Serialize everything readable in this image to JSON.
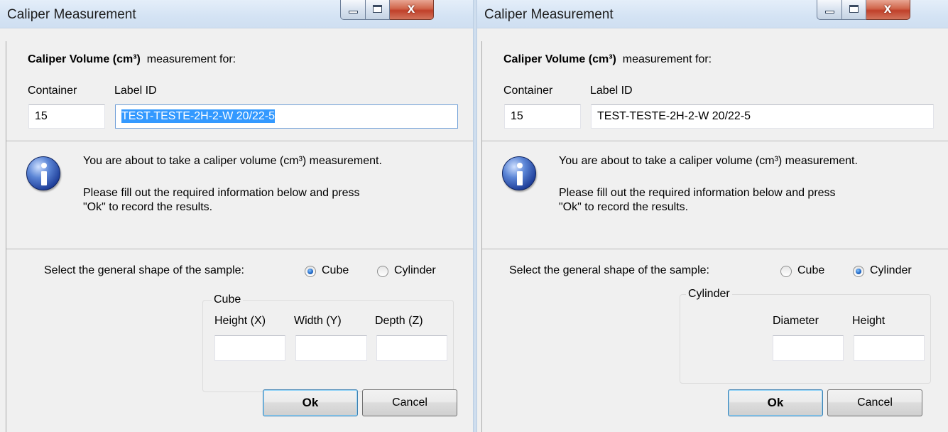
{
  "dialogs": [
    {
      "title": "Caliper Measurement",
      "header_bold": "Caliper Volume (cm³)",
      "header_rest": "measurement for:",
      "container_label": "Container",
      "label_id_label": "Label ID",
      "container_value": "15",
      "label_id_value": "TEST-TESTE-2H-2-W 20/22-5",
      "info_line1": "You are about to take a caliper volume (cm³) measurement.",
      "info_line2": "Please fill out the required information below and press",
      "info_line3": "\"Ok\" to record the results.",
      "shape_prompt": "Select the general shape of the sample:",
      "shape_options": [
        "Cube",
        "Cylinder"
      ],
      "selected_shape": "Cube",
      "group_title": "Cube",
      "fields": [
        "Height (X)",
        "Width (Y)",
        "Depth (Z)"
      ],
      "field_values": [
        "",
        "",
        ""
      ],
      "ok_label": "Ok",
      "cancel_label": "Cancel"
    },
    {
      "title": "Caliper Measurement",
      "header_bold": "Caliper Volume (cm³)",
      "header_rest": "measurement for:",
      "container_label": "Container",
      "label_id_label": "Label ID",
      "container_value": "15",
      "label_id_value": "TEST-TESTE-2H-2-W 20/22-5",
      "info_line1": "You are about to take a caliper volume (cm³) measurement.",
      "info_line2": "Please fill out the required information below and press",
      "info_line3": "\"Ok\" to record the results.",
      "shape_prompt": "Select the general shape of the sample:",
      "shape_options": [
        "Cube",
        "Cylinder"
      ],
      "selected_shape": "Cylinder",
      "group_title": "Cylinder",
      "fields": [
        "Diameter",
        "Height"
      ],
      "field_values": [
        "",
        ""
      ],
      "ok_label": "Ok",
      "cancel_label": "Cancel"
    }
  ],
  "title_buttons": {
    "close_glyph": "x"
  },
  "colors": {
    "selection": "#3399ff",
    "titlebar": "#d4e3f4",
    "close": "#c0402a"
  }
}
